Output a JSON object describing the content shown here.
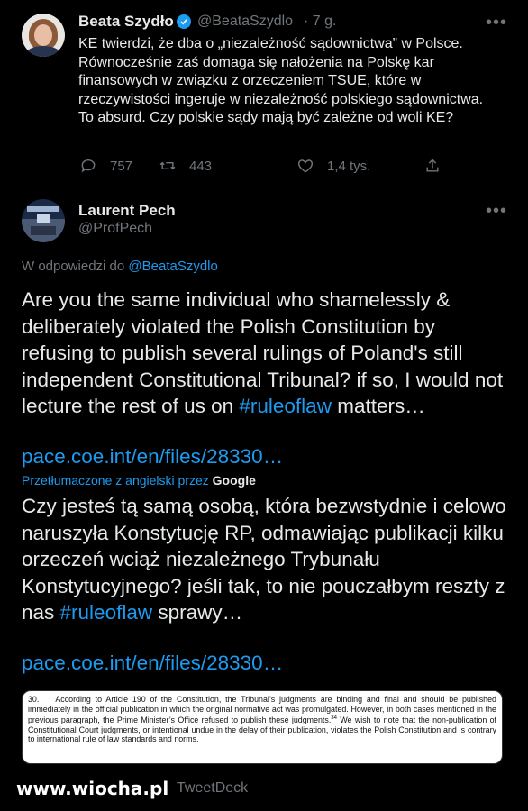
{
  "tweet1": {
    "author_name": "Beata Szydło",
    "author_handle": "@BeataSzydlo",
    "time": "· 7 g.",
    "text": "KE twierdzi, że dba o „niezależność sądownictwa” w Polsce. Równocześnie zaś domaga się nałożenia na Polskę kar finansowych w związku z orzeczeniem TSUE, które w rzeczywistości ingeruje w niezależność polskiego sądownictwa. To absurd. Czy polskie sądy mają być zależne od woli KE?",
    "replies": "757",
    "retweets": "443",
    "likes": "1,4 tys.",
    "more": "•••"
  },
  "tweet2": {
    "author_name": "Laurent Pech",
    "author_handle": "@ProfPech",
    "more": "•••",
    "reply_prefix": "W odpowiedzi do",
    "reply_mention": "@BeataSzydlo",
    "text_en_before": "Are you the same individual who shamelessly & deliberately violated the Polish Constitution by refusing to publish several rulings of Poland's still independent Constitutional Tribunal? if so, I would not lecture the rest of us on ",
    "hashtag": "#ruleoflaw",
    "text_en_after": " matters…",
    "link": "pace.coe.int/en/files/28330…",
    "translated_label": "Przetłumaczone z angielski przez",
    "translated_by": "Google",
    "text_pl_before": "Czy jesteś tą samą osobą, która bezwstydnie i celowo naruszyła Konstytucję RP, odmawiając publikacji kilku orzeczeń wciąż niezależnego Trybunału Konstytucyjnego? jeśli tak, to nie pouczałbym reszty z nas ",
    "text_pl_after": " sprawy…",
    "source": "TweetDeck"
  },
  "document": {
    "number": "30.",
    "text_a": "According to Article 190 of the Constitution, the Tribunal’s judgments are binding and final and should be published immediately in the official publication in which the original normative act was promulgated. However, in both cases mentioned in the previous paragraph, the Prime Minister’s Office refused to publish these judgments.",
    "footnote": "34",
    "text_b": " We wish to note that the non-publication of Constitutional Court judgments, or intentional undue in the delay of their publication, violates the Polish Constitution and is contrary to international rule of law standards and norms."
  },
  "watermark": "www.wiocha.pl",
  "colors": {
    "background": "#000000",
    "text": "#e7e9ea",
    "muted": "#71767b",
    "accent": "#1d9bf0"
  }
}
